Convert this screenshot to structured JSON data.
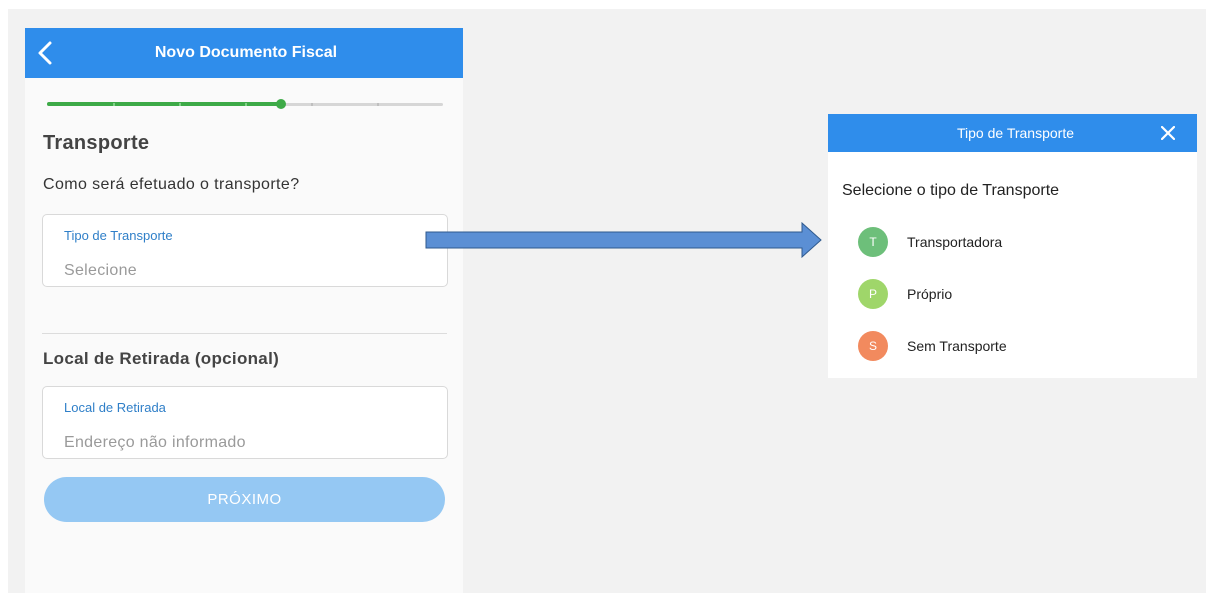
{
  "form": {
    "header_title": "Novo Documento Fiscal",
    "progress": 0.59,
    "progress_steps": 6,
    "section_title": "Transporte",
    "question": "Como será efetuado o transporte?",
    "transport_field": {
      "label": "Tipo de Transporte",
      "value": "Selecione"
    },
    "pickup_section_title": "Local de Retirada (opcional)",
    "pickup_field": {
      "label": "Local de Retirada",
      "value": "Endereço não informado"
    },
    "next_label": "PRÓXIMO"
  },
  "modal": {
    "title": "Tipo de Transporte",
    "subtitle": "Selecione o tipo de Transporte",
    "options": [
      {
        "initial": "T",
        "label": "Transportadora",
        "color": "#6dbf7a"
      },
      {
        "initial": "P",
        "label": "Próprio",
        "color": "#9fd66a"
      },
      {
        "initial": "S",
        "label": "Sem Transporte",
        "color": "#f28a5e"
      }
    ]
  },
  "colors": {
    "primary": "#2f8deb",
    "progress": "#3daa47",
    "button_disabled": "#95c8f3",
    "arrow_fill": "#5b8fd4",
    "arrow_stroke": "#2f5a8e"
  },
  "icons": {
    "back": "chevron-left-icon",
    "close": "close-icon"
  }
}
